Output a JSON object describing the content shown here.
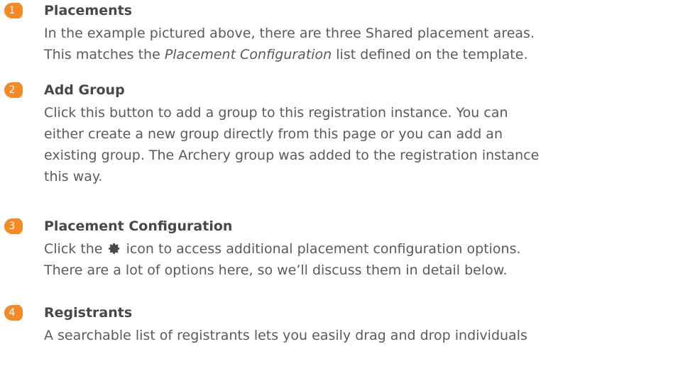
{
  "items": [
    {
      "number": "1",
      "title": "Placements",
      "lines": [
        "In the example pictured above, there are three Shared placement areas.",
        "This matches the ",
        "Placement Configuration",
        " list defined on the template."
      ]
    },
    {
      "number": "2",
      "title": "Add Group",
      "lines": [
        "Click this button to add a group to this registration instance. You can",
        "either create a new group directly from this page or you can add an",
        "existing group. The Archery group was added to the registration instance",
        "this way."
      ]
    },
    {
      "number": "3",
      "title": "Placement Configuration",
      "lines": [
        "Click the ",
        " icon to access additional placement configuration options.",
        "There are a lot of options here, so we’ll discuss them in detail below."
      ],
      "icon": "gear-icon"
    },
    {
      "number": "4",
      "title": "Registrants",
      "lines": [
        "A searchable list of registrants lets you easily drag and drop individuals"
      ]
    }
  ],
  "colors": {
    "badge": "#f58a24",
    "title": "#484848",
    "body": "#5a5a5a"
  }
}
